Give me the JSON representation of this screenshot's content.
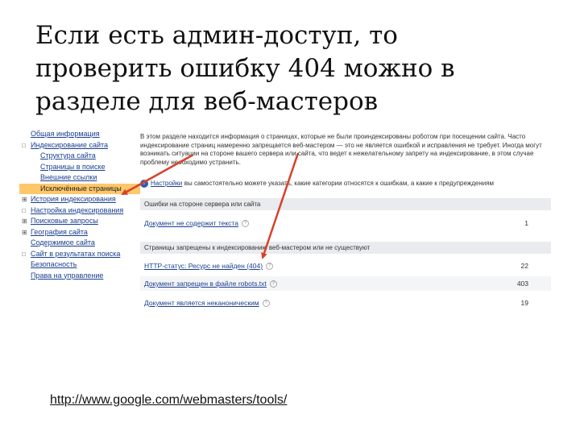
{
  "title": "Если есть админ-доступ, то проверить ошибку 404 можно в разделе для веб-мастеров",
  "sidebar": {
    "items": [
      {
        "label": "Общая информация",
        "toggle": "",
        "level": 0,
        "active": false
      },
      {
        "label": "Индексирование сайта",
        "toggle": "□",
        "level": 0,
        "active": false
      },
      {
        "label": "Структура сайта",
        "toggle": "",
        "level": 1,
        "active": false
      },
      {
        "label": "Страницы в поиске",
        "toggle": "",
        "level": 1,
        "active": false
      },
      {
        "label": "Внешние ссылки",
        "toggle": "",
        "level": 1,
        "active": false
      },
      {
        "label": "Исключённые страницы",
        "toggle": "",
        "level": 1,
        "active": true
      },
      {
        "label": "История индексирования",
        "toggle": "⊞",
        "level": 0,
        "active": false
      },
      {
        "label": "Настройка индексирования",
        "toggle": "□",
        "level": 0,
        "active": false
      },
      {
        "label": "Поисковые запросы",
        "toggle": "⊞",
        "level": 0,
        "active": false
      },
      {
        "label": "География сайта",
        "toggle": "⊞",
        "level": 0,
        "active": false
      },
      {
        "label": "Содержимое сайта",
        "toggle": "",
        "level": 0,
        "active": false
      },
      {
        "label": "Сайт в результатах поиска",
        "toggle": "□",
        "level": 0,
        "active": false
      },
      {
        "label": "Безопасность",
        "toggle": "",
        "level": 0,
        "active": false
      },
      {
        "label": "Права на управление",
        "toggle": "",
        "level": 0,
        "active": false
      }
    ]
  },
  "content": {
    "intro": "В этом разделе находится информация о страницах, которые не были проиндексированы роботом при посещении сайта. Часто индексирование страниц намеренно запрещается веб-мастером — это не является ошибкой и исправления не требует. Иногда могут возникать ситуации на стороне вашего сервера или сайта, что ведет к нежелательному запрету на индексирование, в этом случае проблему необходимо устранить.",
    "notice_link": "Настройки",
    "notice_text": "вы самостоятельно можете указать, какие категории относятся к ошибкам, а какие к предупреждениям",
    "sections": [
      {
        "header": "Ошибки на стороне сервера или сайта",
        "rows": [
          {
            "label": "Документ не содержит текста",
            "count": "1"
          }
        ]
      },
      {
        "header": "Страницы запрещены к индексированию веб-мастером или не существуют",
        "rows": [
          {
            "label": "HTTP-статус: Ресурс не найден (404)",
            "count": "22"
          },
          {
            "label": "Документ запрещен в файле robots.txt",
            "count": "403"
          },
          {
            "label": "Документ является неканоническим",
            "count": "19"
          }
        ]
      }
    ]
  },
  "source_link": "http://www.google.com/webmasters/tools/",
  "colors": {
    "arrow": "#d6422b",
    "active_nav": "#fdc76a",
    "link": "#1a3f8f",
    "section_bg": "#e9ebee"
  }
}
